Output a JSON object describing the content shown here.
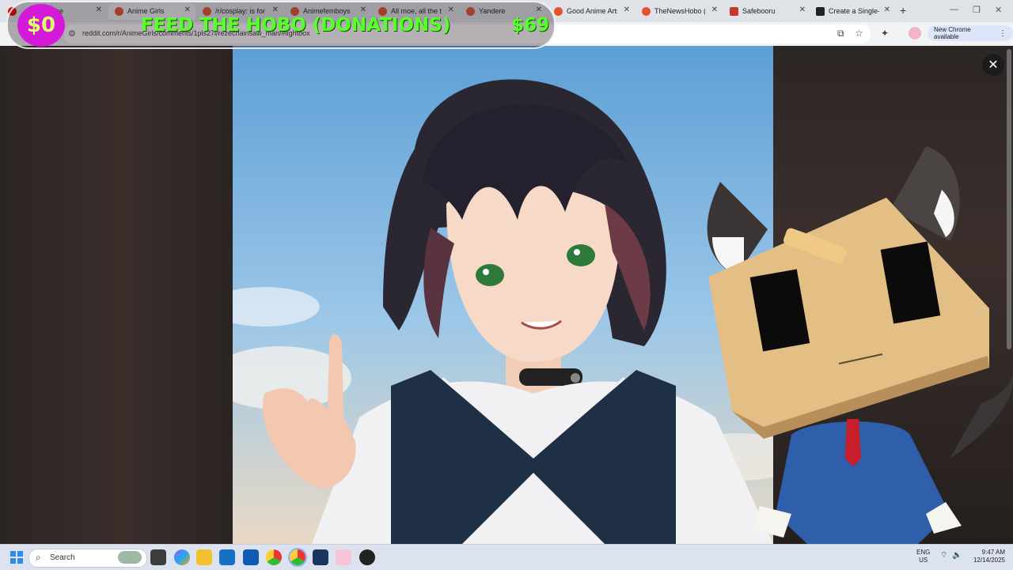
{
  "browser": {
    "tabs": [
      {
        "title": "be",
        "active": false
      },
      {
        "title": "Anime Girls",
        "active": true
      },
      {
        "title": "/r/cosplay: is for",
        "active": false
      },
      {
        "title": "Animefemboys",
        "active": false
      },
      {
        "title": "All moe, all the ti",
        "active": false
      },
      {
        "title": "Yandere",
        "active": false
      },
      {
        "title": "Good Anime Arts",
        "active": false
      },
      {
        "title": "TheNewsHobo (u",
        "active": false
      },
      {
        "title": "Safebooru",
        "active": false
      },
      {
        "title": "Create a Single-U",
        "active": false
      }
    ],
    "url": "reddit.com/r/AnimeGirls/comments/1pls27l/rezechainsaw_man/#lightbox",
    "new_chrome_label": "New Chrome available",
    "new_tab_icon": "plus-icon",
    "close_tab_icon": "close-icon"
  },
  "overlay": {
    "current_amount": "$0",
    "banner_text": "FEED THE HOBO (DONATIONS)",
    "goal_amount": "$69",
    "accent": "#59ff2a",
    "coin_color": "#d21ad8"
  },
  "lightbox": {
    "close_icon": "close-icon"
  },
  "taskbar": {
    "search_placeholder": "Search",
    "lang_line1": "ENG",
    "lang_line2": "US",
    "time": "9:47 AM",
    "date": "12/14/2025"
  }
}
